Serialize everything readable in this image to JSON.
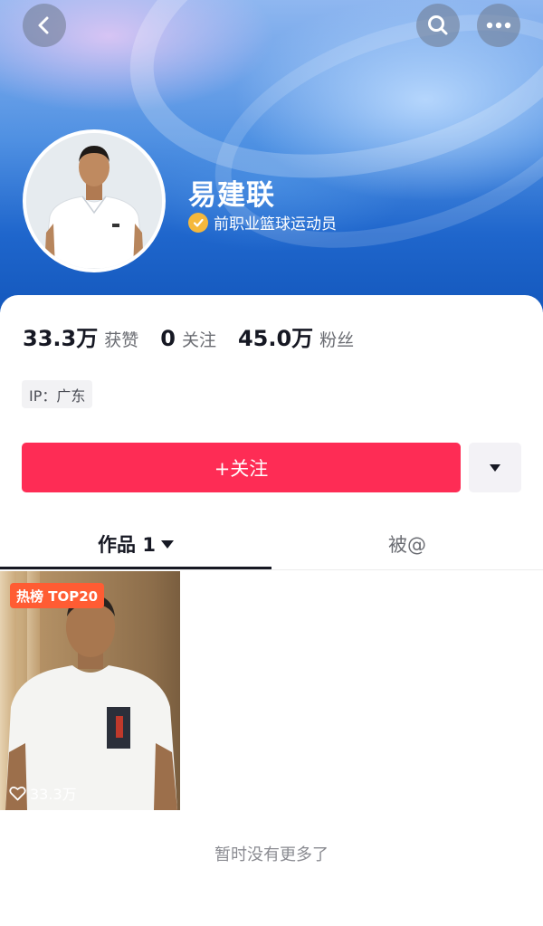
{
  "header": {
    "back_icon": "chevron-left-icon",
    "search_icon": "search-icon",
    "more_icon": "more-dots-icon"
  },
  "profile": {
    "name": "易建联",
    "verified_title": "前职业篮球运动员"
  },
  "stats": [
    {
      "value": "33.3万",
      "label": "获赞"
    },
    {
      "value": "0",
      "label": "关注"
    },
    {
      "value": "45.0万",
      "label": "粉丝"
    }
  ],
  "ip_location": "IP：广东",
  "actions": {
    "follow_label": "+关注"
  },
  "tabs": [
    {
      "label": "作品 1",
      "active": true
    },
    {
      "label": "被@",
      "active": false
    }
  ],
  "videos": [
    {
      "badge": "热榜 TOP20",
      "likes": "33.3万"
    }
  ],
  "footer_text": "暂时没有更多了",
  "colors": {
    "accent": "#fe2c55",
    "verified_badge": "#f5b83c",
    "hot_badge": "#ff5c33"
  }
}
